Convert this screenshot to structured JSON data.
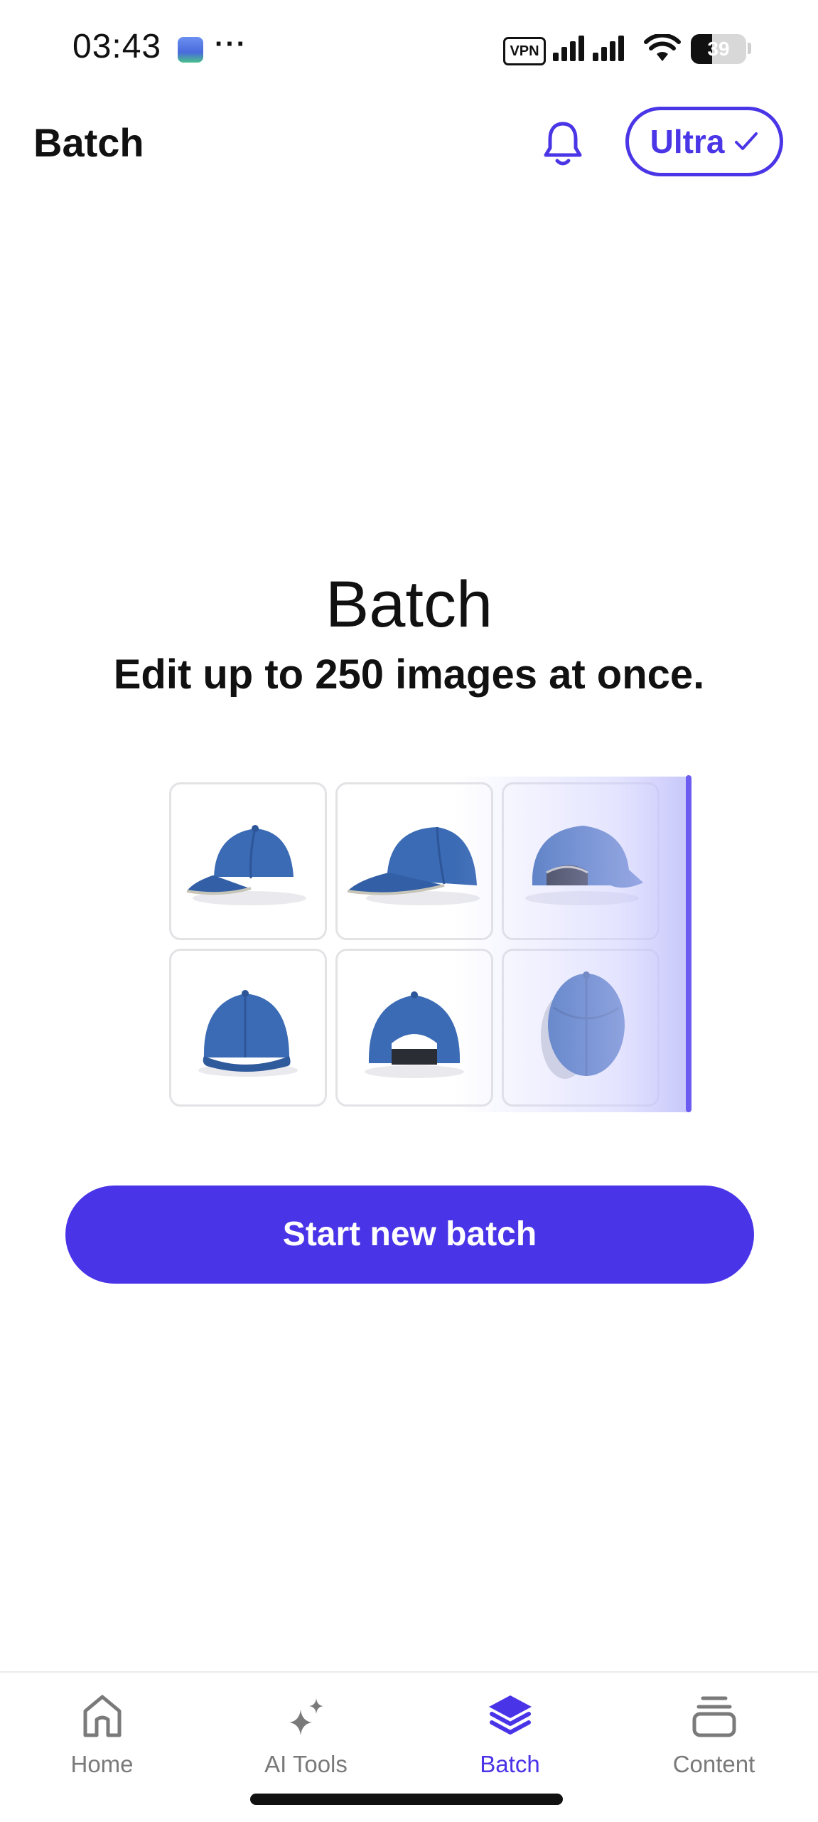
{
  "status_bar": {
    "time": "03:43",
    "more": "···",
    "vpn": "VPN",
    "battery": "39"
  },
  "header": {
    "title": "Batch",
    "plan_label": "Ultra"
  },
  "hero": {
    "title": "Batch",
    "subtitle": "Edit up to 250 images at once."
  },
  "grid": {
    "images": [
      "cap-front-left",
      "cap-side",
      "cap-back-side",
      "cap-front",
      "cap-back",
      "cap-top"
    ]
  },
  "cta": {
    "label": "Start new batch"
  },
  "bottom_nav": {
    "items": [
      {
        "label": "Home",
        "icon": "home-icon",
        "active": false
      },
      {
        "label": "AI Tools",
        "icon": "sparkles-icon",
        "active": false
      },
      {
        "label": "Batch",
        "icon": "layers-icon",
        "active": true
      },
      {
        "label": "Content",
        "icon": "stack-icon",
        "active": false
      }
    ]
  },
  "colors": {
    "accent": "#4a34e8",
    "cap": "#3b6bb5"
  }
}
